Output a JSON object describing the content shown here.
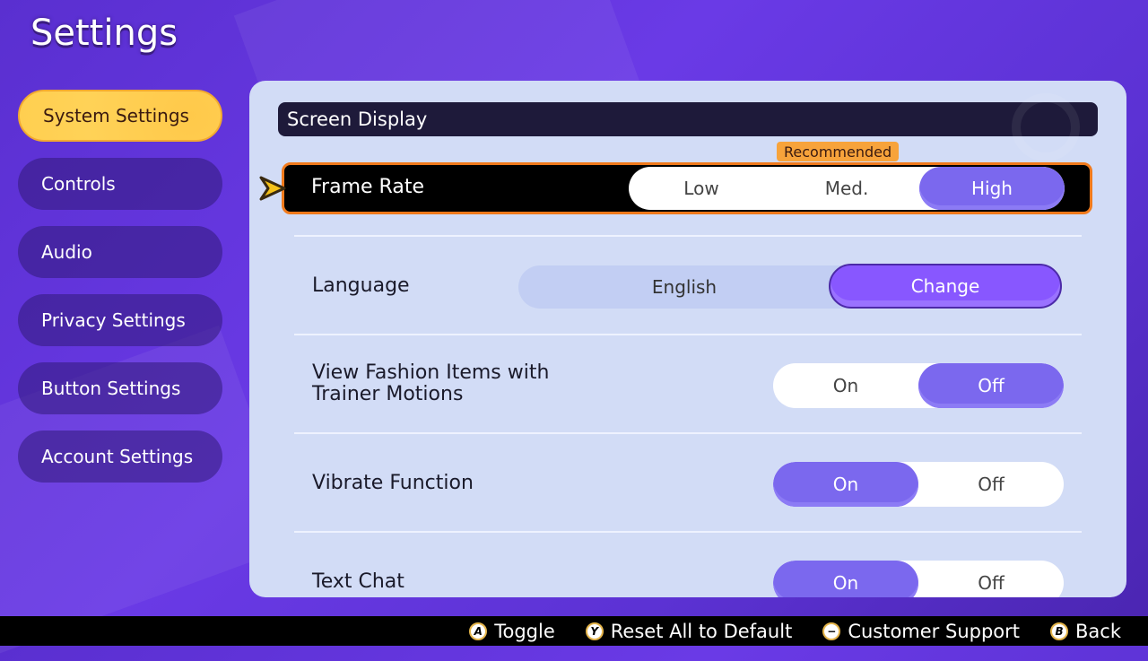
{
  "title": "Settings",
  "sidebar": {
    "items": [
      {
        "label": "System Settings",
        "active": true
      },
      {
        "label": "Controls",
        "active": false
      },
      {
        "label": "Audio",
        "active": false
      },
      {
        "label": "Privacy Settings",
        "active": false
      },
      {
        "label": "Button Settings",
        "active": false
      },
      {
        "label": "Account Settings",
        "active": false
      }
    ]
  },
  "section": {
    "header": "Screen Display"
  },
  "settings": {
    "frame_rate": {
      "label": "Frame Rate",
      "options": [
        "Low",
        "Med.",
        "High"
      ],
      "selected": "High",
      "badge": "Recommended",
      "badge_target": "Med."
    },
    "language": {
      "label": "Language",
      "value": "English",
      "button": "Change"
    },
    "fashion": {
      "label_line1": "View Fashion Items with",
      "label_line2": "Trainer Motions",
      "options": [
        "On",
        "Off"
      ],
      "selected": "Off"
    },
    "vibrate": {
      "label": "Vibrate Function",
      "options": [
        "On",
        "Off"
      ],
      "selected": "On"
    },
    "text_chat": {
      "label": "Text Chat",
      "options": [
        "On",
        "Off"
      ],
      "selected": "On"
    }
  },
  "footer": {
    "hints": [
      {
        "glyph": "A",
        "label": "Toggle"
      },
      {
        "glyph": "Y",
        "label": "Reset All to Default"
      },
      {
        "glyph": "−",
        "label": "Customer Support"
      },
      {
        "glyph": "B",
        "label": "Back"
      }
    ]
  },
  "colors": {
    "accent": "#7b68ee",
    "highlight": "#f07a1c",
    "active_tab": "#ffd257"
  }
}
